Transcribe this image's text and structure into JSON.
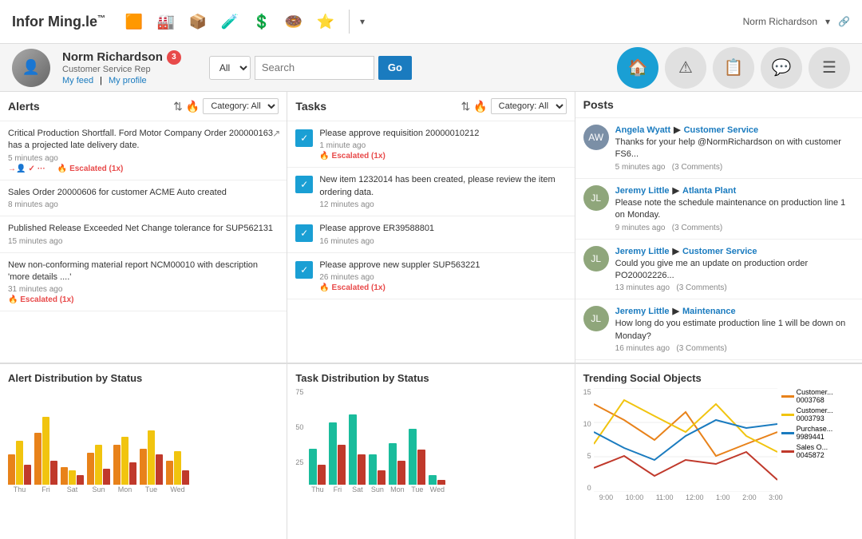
{
  "app": {
    "title": "Infor Ming.le",
    "title_sup": "™"
  },
  "topnav": {
    "user": "Norm Richardson",
    "icons": [
      "🟧",
      "🏭",
      "📦",
      "🧪",
      "💲",
      "🍩",
      "⭐"
    ],
    "chevron": "▾"
  },
  "userbar": {
    "name": "Norm Richardson",
    "badge": "3",
    "role": "Customer Service Rep",
    "feed_link": "My feed",
    "profile_link": "My profile",
    "search_placeholder": "Search",
    "search_filter": "All",
    "search_btn": "Go"
  },
  "right_icons": [
    "🏠",
    "⚠",
    "📋",
    "💬",
    "☰"
  ],
  "alerts": {
    "title": "Alerts",
    "items": [
      {
        "text": "Critical Production Shortfall. Ford Motor Company Order 200000163 has a projected late delivery date.",
        "time": "5 minutes ago",
        "escalated": "Escalated (1x)",
        "has_external": true,
        "has_actions": true
      },
      {
        "text": "Sales Order 20000606 for customer ACME Auto created",
        "time": "8 minutes ago",
        "escalated": "",
        "has_external": false,
        "has_actions": false
      },
      {
        "text": "Published Release Exceeded Net Change tolerance for SUP562131",
        "time": "15 minutes ago",
        "escalated": "",
        "has_external": false,
        "has_actions": false
      },
      {
        "text": "New non-conforming material report NCM00010 with description 'more details ....'",
        "time": "31 minutes ago",
        "escalated": "Escalated (1x)",
        "has_external": false,
        "has_actions": false
      }
    ]
  },
  "tasks": {
    "title": "Tasks",
    "items": [
      {
        "text": "Please approve requisition 20000010212",
        "time": "1 minute ago",
        "escalated": "Escalated (1x)"
      },
      {
        "text": "New item 1232014 has been created, please review the item ordering data.",
        "time": "12 minutes ago",
        "escalated": ""
      },
      {
        "text": "Please approve ER39588801",
        "time": "16 minutes ago",
        "escalated": ""
      },
      {
        "text": "Please approve new suppler SUP563221",
        "time": "26 minutes ago",
        "escalated": "Escalated (1x)"
      }
    ]
  },
  "posts": {
    "title": "Posts",
    "items": [
      {
        "author": "Angela Wyatt",
        "dest": "Customer Service",
        "text": "Thanks for your help @NormRichardson on with customer FS6...",
        "time": "5 minutes ago",
        "comments": "(3 Comments)",
        "avatar_color": "#7b8fa6",
        "initials": "AW"
      },
      {
        "author": "Jeremy Little",
        "dest": "Atlanta Plant",
        "text": "Please note the schedule maintenance on production line 1 on Monday.",
        "time": "9 minutes ago",
        "comments": "(3 Comments)",
        "avatar_color": "#8fa67b",
        "initials": "JL"
      },
      {
        "author": "Jeremy Little",
        "dest": "Customer Service",
        "text": "Could you give me an update on production order PO20002226...",
        "time": "13 minutes ago",
        "comments": "(3 Comments)",
        "avatar_color": "#8fa67b",
        "initials": "JL"
      },
      {
        "author": "Jeremy Little",
        "dest": "Maintenance",
        "text": "How long do you estimate production line 1 will be down on Monday?",
        "time": "16 minutes ago",
        "comments": "(3 Comments)",
        "avatar_color": "#8fa67b",
        "initials": "JL"
      }
    ]
  },
  "charts": {
    "alert_dist_title": "Alert Distribution by Status",
    "task_dist_title": "Task Distribution by Status",
    "trending_title": "Trending Social Objects",
    "bar_labels": [
      "Thu",
      "Fri",
      "Sat",
      "Sun",
      "Mon",
      "Tue",
      "Wed"
    ],
    "alert_bars": [
      [
        30,
        45,
        20
      ],
      [
        55,
        60,
        25
      ],
      [
        20,
        15,
        10
      ],
      [
        35,
        40,
        18
      ],
      [
        42,
        50,
        22
      ],
      [
        38,
        55,
        30
      ],
      [
        25,
        35,
        15
      ]
    ],
    "task_bars_teal": [
      35,
      60,
      70,
      30,
      40,
      55,
      10
    ],
    "task_bars_red": [
      20,
      40,
      30,
      15,
      25,
      35,
      5
    ],
    "task_y_labels": [
      "75",
      "50",
      "25"
    ],
    "trending_x_labels": [
      "9:00",
      "10:00",
      "11:00",
      "12:00",
      "1:00",
      "2:00",
      "3:00"
    ],
    "trending_y_labels": [
      "15",
      "10",
      "5",
      "0"
    ],
    "legend_items": [
      {
        "label": "Customer... 0003768",
        "color": "#e8821a"
      },
      {
        "label": "Customer... 0003793",
        "color": "#f1c40f"
      },
      {
        "label": "Purchase... 9989441",
        "color": "#1a7bbf"
      },
      {
        "label": "Sales O... 0045872",
        "color": "#c0392b"
      }
    ]
  }
}
